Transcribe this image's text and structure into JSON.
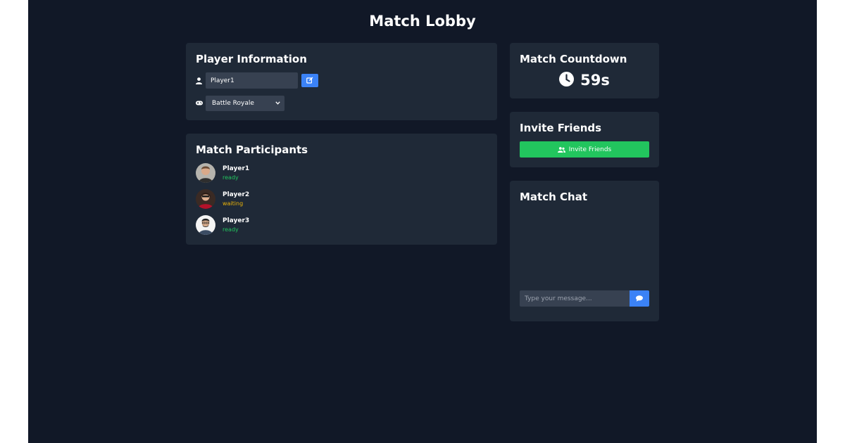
{
  "page": {
    "title": "Match Lobby"
  },
  "player_info": {
    "title": "Player Information",
    "name_value": "Player1",
    "mode_selected": "Battle Royale"
  },
  "participants": {
    "title": "Match Participants",
    "items": [
      {
        "name": "Player1",
        "status": "ready"
      },
      {
        "name": "Player2",
        "status": "waiting"
      },
      {
        "name": "Player3",
        "status": "ready"
      }
    ]
  },
  "countdown": {
    "title": "Match Countdown",
    "value": "59s"
  },
  "invite": {
    "title": "Invite Friends",
    "button_label": "Invite Friends"
  },
  "chat": {
    "title": "Match Chat",
    "placeholder": "Type your message..."
  },
  "colors": {
    "background": "#111827",
    "card": "#1f2937",
    "input": "#374151",
    "primary": "#3b82f6",
    "success": "#22c55e",
    "warning": "#eab308"
  },
  "icons": {
    "name_row": "user-icon",
    "edit": "edit-icon",
    "mode_row": "gamepad-icon",
    "countdown": "clock-icon",
    "invite": "user-group-icon",
    "send": "chat-bubble-icon"
  }
}
